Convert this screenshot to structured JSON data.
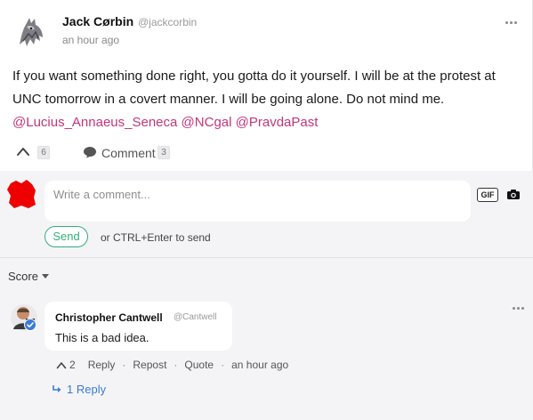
{
  "post": {
    "author_name": "Jack Cørbin",
    "author_handle": "@jackcorbin",
    "time": "an hour ago",
    "text_main": "If you want something done right, you gotta do it yourself. I will be at the protest at UNC tomorrow in a covert manner. I will be going alone. Do not mind me. ",
    "mentions": [
      "@Lucius_Annaeus_Seneca",
      "@NCgal",
      "@PravdaPast"
    ],
    "upvotes": "6",
    "comment_label": "Comment",
    "comment_count": "3",
    "icons": [
      "wolf-avatar-icon",
      "ellipsis-icon",
      "chevron-up-icon",
      "speech-bubble-icon"
    ]
  },
  "compose": {
    "placeholder": "Write a comment...",
    "gif_label": "GIF",
    "send_label": "Send",
    "hint": "or CTRL+Enter to send",
    "icons": [
      "red-avatar-icon",
      "camera-icon"
    ]
  },
  "comments": {
    "sort_label": "Score",
    "items": [
      {
        "author_name": "Christopher Cantwell",
        "author_handle": "@Cantwell",
        "text": "This is a bad idea.",
        "upvotes": "2",
        "reply_label": "Reply",
        "repost_label": "Repost",
        "quote_label": "Quote",
        "time": "an hour ago",
        "replies_label": "1 Reply"
      }
    ]
  },
  "colors": {
    "mention": "#c2367a",
    "send": "#31b07a",
    "link": "#3b7bd6",
    "background": "#f4f4f6"
  }
}
